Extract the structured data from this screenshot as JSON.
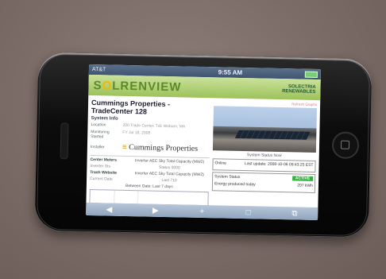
{
  "status": {
    "carrier": "AT&T",
    "time": "9:55 AM"
  },
  "banner": {
    "brand_a": "S",
    "brand_b": "LRENVIEW",
    "brand_o": "O",
    "partner_line1": "SOLECTRIA",
    "partner_line2": "RENEWABLES"
  },
  "page": {
    "title": "Cummings Properties - TradeCenter 128",
    "date_link": "Refresh Graphs",
    "system_info_heading": "System Info",
    "location_label": "Location",
    "location_value": "200 Trade Center, Tdc Woburn, MA",
    "monitoring_label": "Monitoring Started",
    "monitoring_value": "FY Jul 18, 2008",
    "installer_label": "Installer",
    "logo_text_b": "≡",
    "logo_text": "Cummings Properties",
    "meter_rows": [
      {
        "a": "Center Meters",
        "b": "Inverter AEC  Sky  Total Capacity (MW2)"
      },
      {
        "a": "Inverter Sts",
        "b": "Status        0000"
      },
      {
        "a": "Trash Website",
        "b": "Inverter AEC  Sky  Total Capacity (MW2)"
      },
      {
        "a": "Current Date",
        "b": "Last  710"
      }
    ],
    "graph_caption": "Between Date: Last 7 days",
    "photo_caption": "System Status Now",
    "box_line1_a": "Online",
    "box_line1_b": "Last update: 2008-10-06 09:43:25 EST",
    "status_label": "System Status",
    "status_value": "ACTIVE",
    "energy_label": "Energy produced today",
    "energy_value": "207 kWh"
  },
  "toolbar": {
    "back": "◀",
    "forward": "▶",
    "add": "+",
    "bookmarks": "□",
    "pages": "⧉"
  }
}
